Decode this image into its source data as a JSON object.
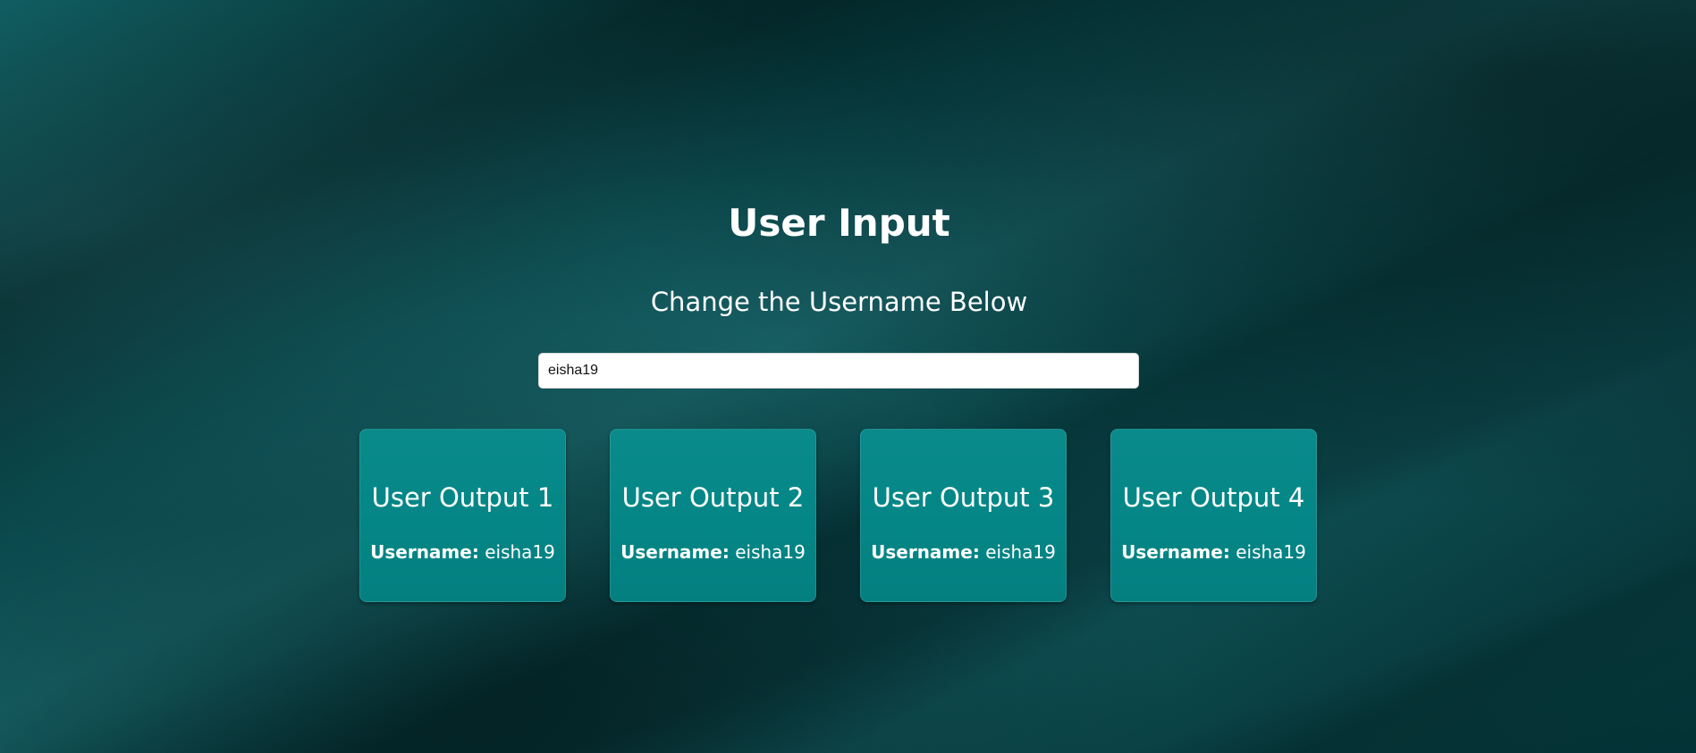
{
  "page": {
    "title": "User Input",
    "subtitle": "Change the Username Below"
  },
  "input": {
    "value": "eisha19"
  },
  "cards": [
    {
      "title": "User Output 1",
      "username_label": "Username:",
      "username_value": "eisha19"
    },
    {
      "title": "User Output 2",
      "username_label": "Username:",
      "username_value": "eisha19"
    },
    {
      "title": "User Output 3",
      "username_label": "Username:",
      "username_value": "eisha19"
    },
    {
      "title": "User Output 4",
      "username_label": "Username:",
      "username_value": "eisha19"
    }
  ],
  "colors": {
    "background": "#063e41",
    "card": "#058686",
    "text": "#ffffff",
    "input_background": "#ffffff"
  }
}
